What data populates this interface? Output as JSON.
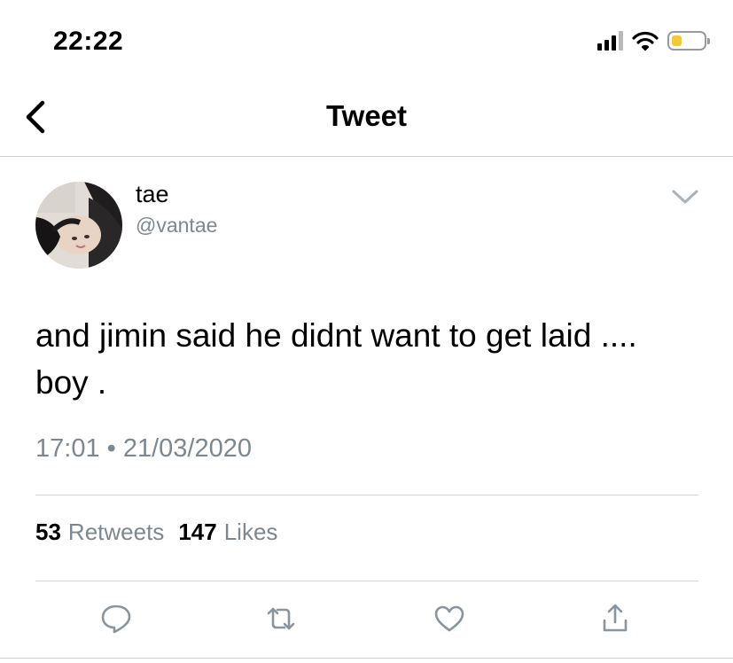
{
  "status_bar": {
    "time": "22:22",
    "signal_icon": "cellular-signal-icon",
    "wifi_icon": "wifi-icon",
    "battery_icon": "battery-icon",
    "battery_level": 0.3,
    "battery_color": "#f1c93a"
  },
  "nav": {
    "back_icon": "chevron-left-icon",
    "title": "Tweet"
  },
  "tweet": {
    "author_name": "tae",
    "author_handle": "@vantae",
    "more_icon": "chevron-down-icon",
    "text": "and jimin said he didnt want to get laid .... boy .",
    "time": "17:01",
    "separator": "•",
    "date": "21/03/2020",
    "retweets_count": "53",
    "retweets_label": "Retweets",
    "likes_count": "147",
    "likes_label": "Likes"
  },
  "actions": {
    "reply_icon": "reply-icon",
    "retweet_icon": "retweet-icon",
    "like_icon": "heart-icon",
    "share_icon": "share-icon"
  },
  "colors": {
    "text": "#000000",
    "secondary_text": "#7d8790",
    "divider": "#d3d3d3",
    "icon": "#8a949c"
  }
}
